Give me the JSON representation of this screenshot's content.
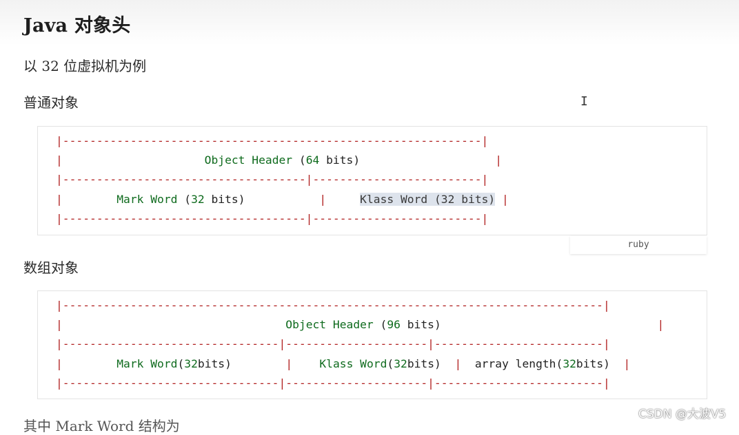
{
  "title": "Java 对象头",
  "intro": "以 32 位虚拟机为例",
  "sections": [
    {
      "heading": "普通对象",
      "code_lang": "ruby",
      "header_label": "Object Header",
      "header_bits": "64",
      "fields": [
        {
          "name": "Mark Word",
          "bits": "32"
        },
        {
          "name": "Klass Word",
          "bits": "32"
        }
      ]
    },
    {
      "heading": "数组对象",
      "header_label": "Object Header",
      "header_bits": "96",
      "fields": [
        {
          "name": "Mark Word",
          "bits": "32"
        },
        {
          "name": "Klass Word",
          "bits": "32"
        },
        {
          "name": "array length",
          "bits": "32"
        }
      ]
    }
  ],
  "next_paragraph_partial": "其中 Mark Word 结构为",
  "watermark": "CSDN @大波V5",
  "colors": {
    "border_dash": "#b22222",
    "identifier": "#0f6b1e",
    "highlight": "#dde3ec"
  }
}
